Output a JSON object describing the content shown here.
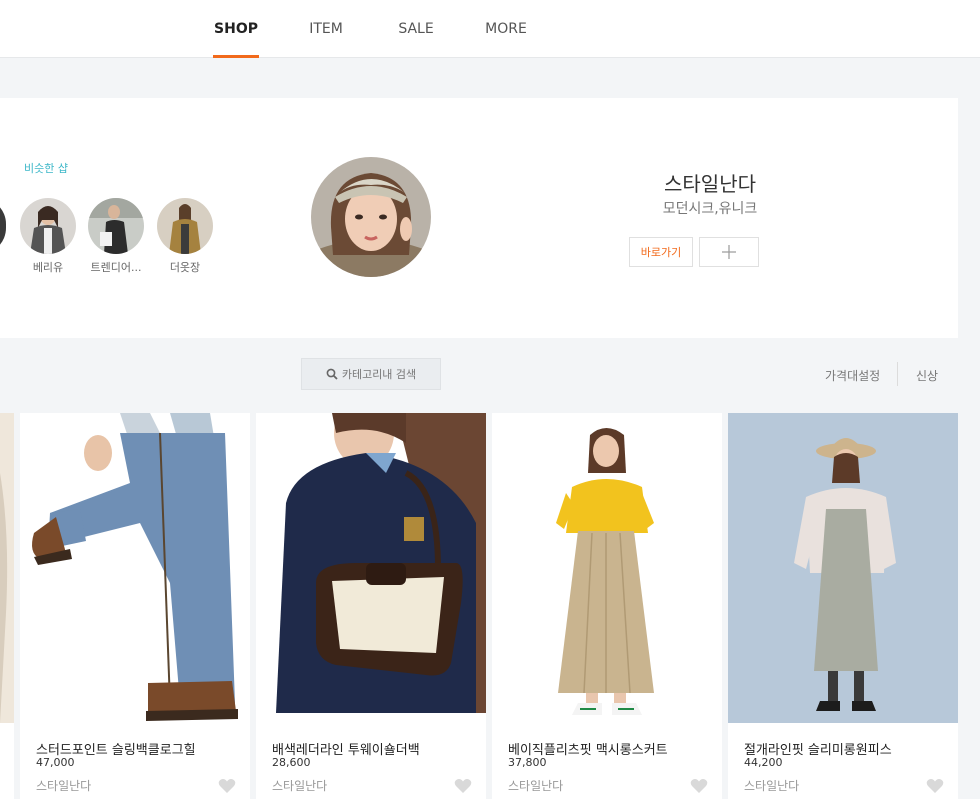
{
  "nav": {
    "tabs": [
      "SHOP",
      "ITEM",
      "SALE",
      "MORE"
    ],
    "active": "SHOP",
    "accent_color": "#f26a1b"
  },
  "similar": {
    "label": "비슷한 샵",
    "label_color": "#3cb7c8",
    "shops": [
      {
        "name": "베리유"
      },
      {
        "name": "트렌디어..."
      },
      {
        "name": "더옷장"
      }
    ]
  },
  "shop": {
    "name": "스타일난다",
    "tags": "모던시크,유니크",
    "goto_label": "바로가기",
    "follow_icon": "plus-icon"
  },
  "filters": {
    "search_label": "카테고리내 검색",
    "search_icon": "search-icon",
    "price_label": "가격대설정",
    "new_label": "신상"
  },
  "products": [
    {
      "title": "스터드포인트 슬링백클로그힐",
      "price": "47,000",
      "shop": "스타일난다"
    },
    {
      "title": "배색레더라인 투웨이숄더백",
      "price": "28,600",
      "shop": "스타일난다"
    },
    {
      "title": "베이직플리츠핏 맥시롱스커트",
      "price": "37,800",
      "shop": "스타일난다"
    },
    {
      "title": "절개라인핏 슬리미롱원피스",
      "price": "44,200",
      "shop": "스타일난다"
    }
  ]
}
